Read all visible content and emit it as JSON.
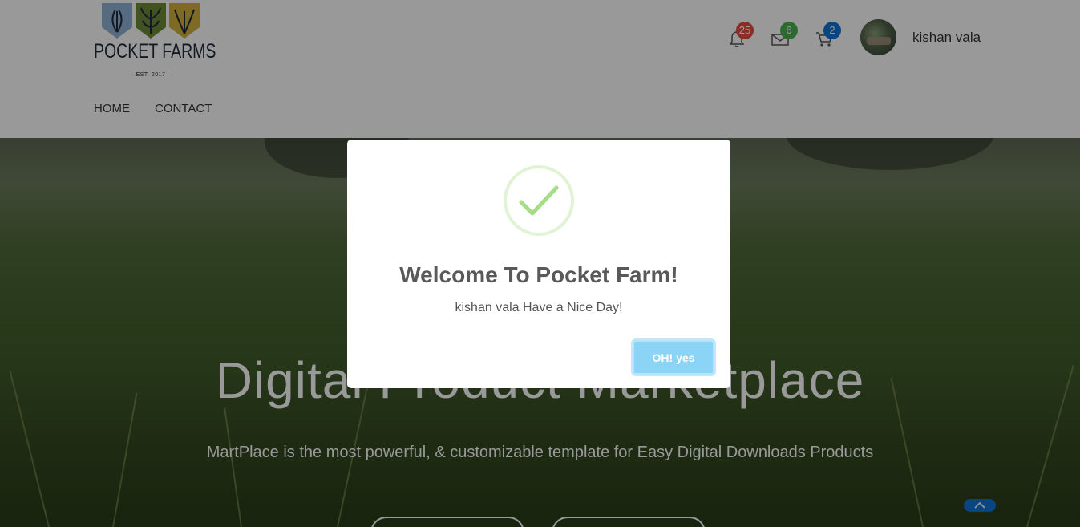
{
  "brand": {
    "name": "POCKET FARMS",
    "tagline": "– EST. 2017 –"
  },
  "nav": {
    "items": [
      "HOME",
      "CONTACT"
    ]
  },
  "header": {
    "notifications_count": "25",
    "messages_count": "6",
    "cart_count": "2",
    "username": "kishan vala"
  },
  "hero": {
    "title": "Digital Product Marketplace",
    "subtitle": "MartPlace is the most powerful, & customizable template for Easy Digital Downloads Products"
  },
  "modal": {
    "title": "Welcome To Pocket Farm!",
    "text": "kishan vala Have a Nice Day!",
    "confirm_label": "OH! yes"
  },
  "colors": {
    "badge_red": "#e74c3c",
    "badge_green": "#4caf50",
    "badge_blue": "#0e73d8",
    "success_green": "#a5dc86",
    "confirm_button": "#8cd4f5"
  }
}
